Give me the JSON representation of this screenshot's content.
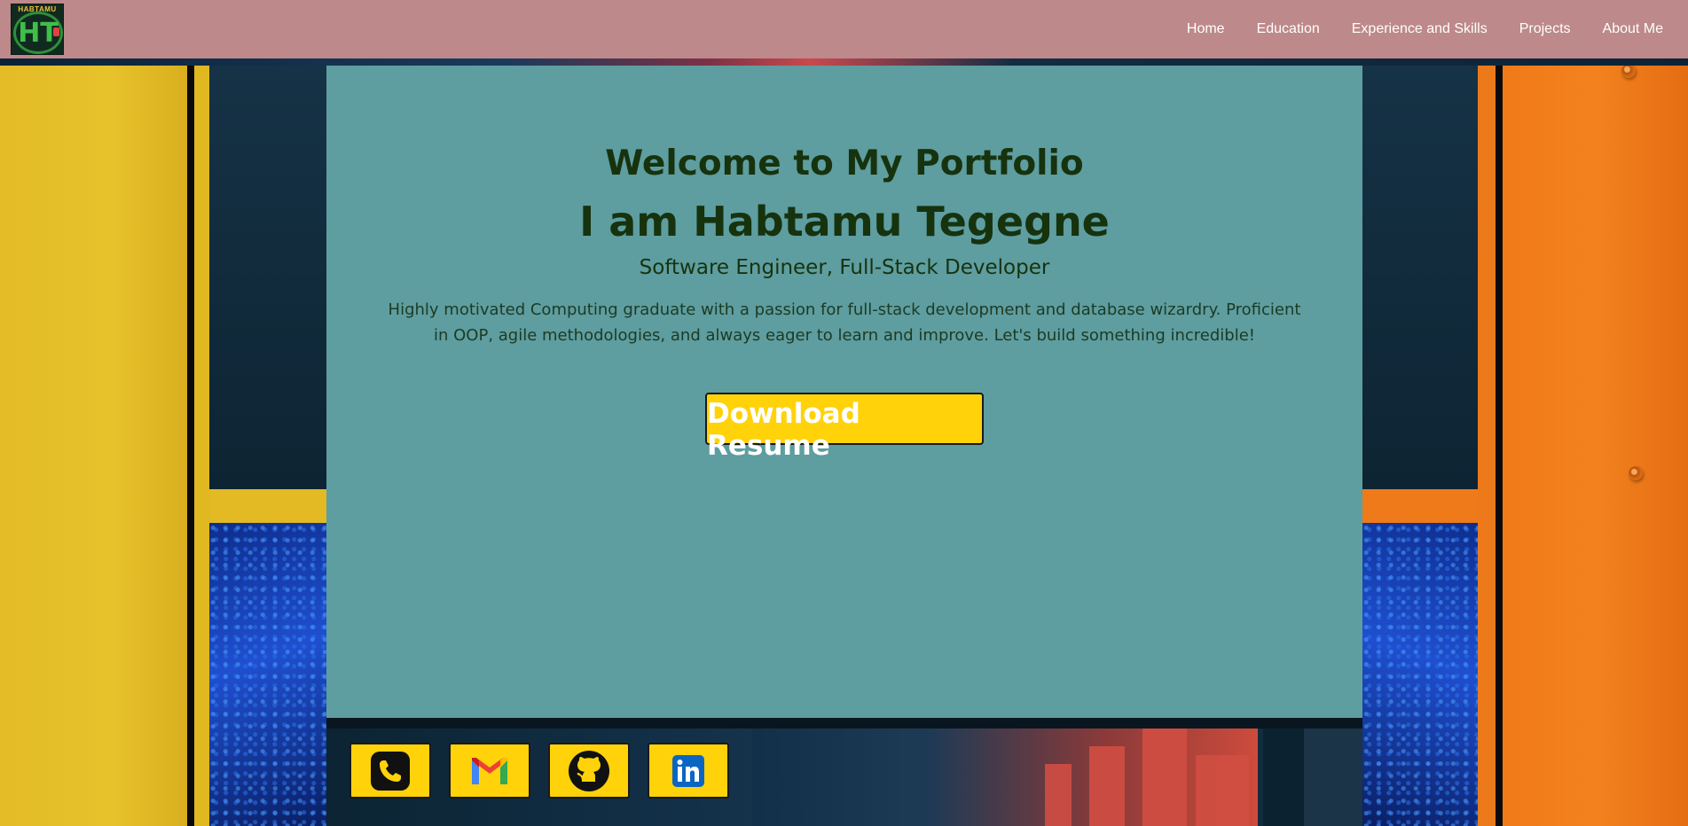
{
  "nav": {
    "logo_text": "HABTAMU",
    "logo_mark": "HT",
    "links": [
      {
        "label": "Home"
      },
      {
        "label": "Education"
      },
      {
        "label": "Experience and Skills"
      },
      {
        "label": "Projects"
      },
      {
        "label": "About Me"
      }
    ]
  },
  "hero": {
    "welcome": "Welcome to My Portfolio",
    "name": "I am Habtamu Tegegne",
    "role": "Software Engineer, Full-Stack Developer",
    "bio": "Highly motivated Computing graduate with a passion for full-stack development and database wizardry. Proficient in OOP, agile methodologies, and always eager to learn and improve. Let's build something incredible!",
    "resume_button": "Download Resume"
  },
  "contacts": [
    {
      "name": "phone",
      "icon": "phone-icon"
    },
    {
      "name": "gmail",
      "icon": "gmail-icon"
    },
    {
      "name": "github",
      "icon": "github-icon"
    },
    {
      "name": "linkedin",
      "icon": "linkedin-icon"
    }
  ],
  "colors": {
    "navbar": "#bd898a",
    "hero_bg": "#5e9da0",
    "heading_text": "#16330e",
    "button_bg": "#ffd20a",
    "left_panel": "#e3bc27",
    "right_panel": "#f07a18"
  }
}
